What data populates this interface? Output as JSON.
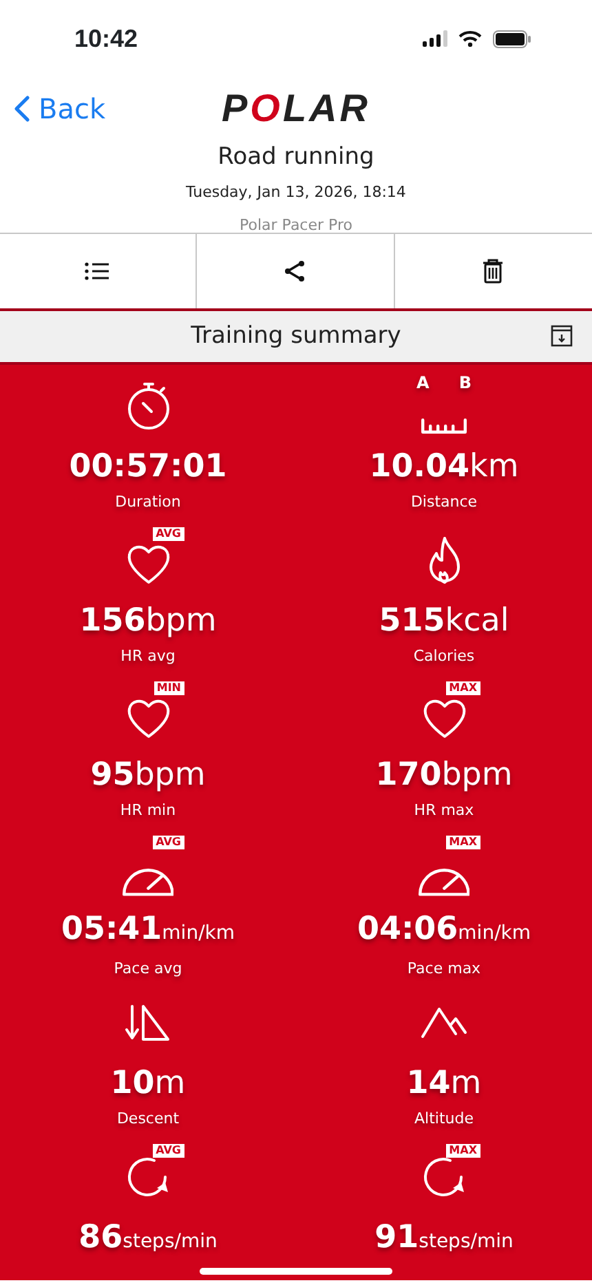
{
  "status_bar": {
    "time": "10:42"
  },
  "header": {
    "back": "Back",
    "logo": "POLAR",
    "title": "Road running",
    "date": "Tuesday, Jan 13, 2026, 18:14",
    "device": "Polar Pacer Pro"
  },
  "toolbar": [
    {
      "kind": "list"
    },
    {
      "kind": "share"
    },
    {
      "kind": "delete"
    }
  ],
  "summary_bar": {
    "title": "Training summary"
  },
  "metric_rows": [
    {
      "cells": [
        {
          "kind": "stopwatch",
          "value": "00:57:01",
          "label": "Duration"
        },
        {
          "kind": "ruler",
          "marks": [
            "A",
            "B"
          ],
          "value": "10.04",
          "unit": "km",
          "label": "Distance"
        }
      ]
    },
    {
      "cells": [
        {
          "kind": "heart",
          "tag": "AVG",
          "value": "156",
          "unit": "bpm",
          "label": "HR avg"
        },
        {
          "kind": "flame",
          "value": "515",
          "unit": "kcal",
          "label": "Calories"
        }
      ]
    },
    {
      "cells": [
        {
          "kind": "heart",
          "tag": "MIN",
          "value": "95",
          "unit": "bpm",
          "label": "HR min"
        },
        {
          "kind": "heart",
          "tag": "MAX",
          "value": "170",
          "unit": "bpm",
          "label": "HR max"
        }
      ]
    },
    {
      "cells": [
        {
          "kind": "gauge",
          "tag": "AVG",
          "value": "05:41",
          "unit": "min/km",
          "label": "Pace avg"
        },
        {
          "kind": "gauge",
          "tag": "MAX",
          "value": "04:06",
          "unit": "min/km",
          "label": "Pace max"
        }
      ]
    },
    {
      "cells": [
        {
          "kind": "descent",
          "value": "10",
          "unit": "m",
          "label": "Descent"
        },
        {
          "kind": "mountain",
          "value": "14",
          "unit": "m",
          "label": "Altitude"
        }
      ]
    },
    {
      "cells": [
        {
          "kind": "cadence",
          "tag": "AVG",
          "value": "86",
          "unit": "steps/min"
        },
        {
          "kind": "cadence",
          "tag": "MAX",
          "value": "91",
          "unit": "steps/min"
        }
      ]
    }
  ]
}
